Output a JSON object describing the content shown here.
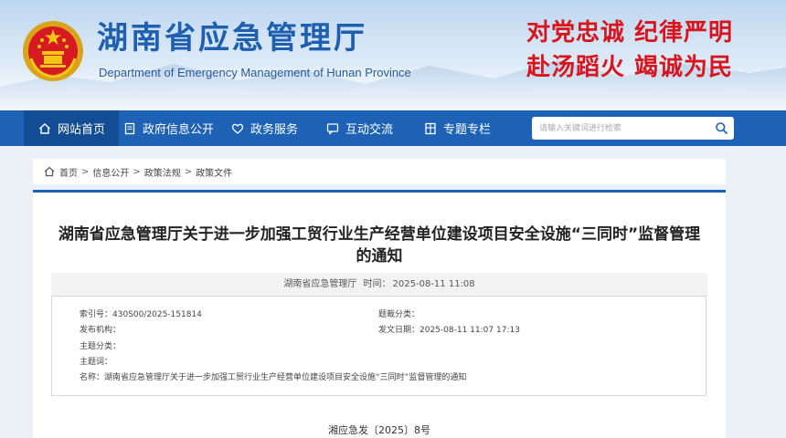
{
  "header": {
    "title": "湖南省应急管理厅",
    "subtitle": "Department of Emergency Management of Hunan Province",
    "slogan_line1": "对党忠诚  纪律严明",
    "slogan_line2": "赴汤蹈火  竭诚为民",
    "title_color": "#1f5fb0",
    "slogan_color": "#d8141c"
  },
  "nav": {
    "items": [
      {
        "label": "网站首页",
        "icon": "home-icon",
        "active": true
      },
      {
        "label": "政府信息公开",
        "icon": "document-icon",
        "active": false
      },
      {
        "label": "政务服务",
        "icon": "heart-icon",
        "active": false
      },
      {
        "label": "互动交流",
        "icon": "chat-icon",
        "active": false
      },
      {
        "label": "专题专栏",
        "icon": "columns-icon",
        "active": false
      }
    ],
    "search_placeholder": "请输入关键词进行检索",
    "bar_color": "#1d62b4"
  },
  "breadcrumb": {
    "items": [
      "首页",
      "信息公开",
      "政策法规",
      "政策文件"
    ],
    "separator": ">"
  },
  "article": {
    "title": "湖南省应急管理厅关于进一步加强工贸行业生产经营单位建设项目安全设施“三同时”监督管理的通知",
    "source": "湖南省应急管理厅",
    "time_label": "时间：",
    "time": "2025-08-11 11:08",
    "info": {
      "index_label": "索引号：",
      "index_value": "430S00/2025-151814",
      "category_label": "题裁分类：",
      "category_value": "",
      "issuer_label": "发布机构：",
      "issuer_value": "",
      "date_label": "发文日期：",
      "date_value": "2025-08-11 11:07 17:13",
      "topic_label": "主题分类：",
      "topic_value": "",
      "keywords_label": "主题词：",
      "keywords_value": "",
      "name_label": "名称：",
      "name_value": "湖南省应急管理厅关于进一步加强工贸行业生产经营单位建设项目安全设施“三同时”监督管理的通知"
    },
    "doc_number": "湘应急发〔2025〕8号"
  }
}
